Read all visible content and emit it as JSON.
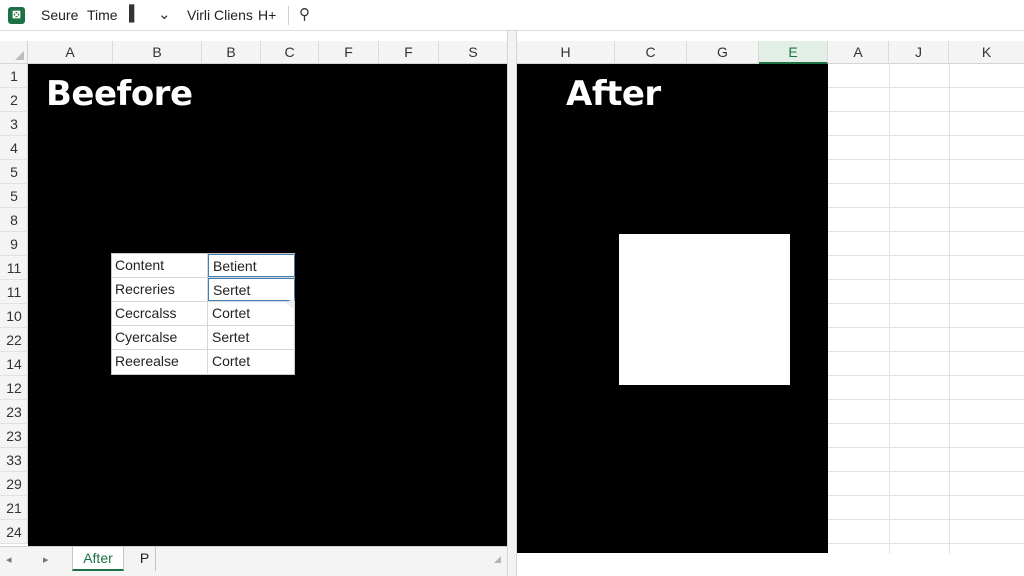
{
  "toolbar": {
    "app_icon": "spreadsheet-app-icon",
    "item1": "Seure",
    "item2": "Time",
    "item3": "Virli Cliens",
    "item4": "H+",
    "icons": [
      "bookmark-icon",
      "chevron-down-icon",
      "person-icon"
    ],
    "glyph_bookmark": "▌",
    "glyph_chevron": "⌄",
    "glyph_person": "⚲"
  },
  "left_pane": {
    "columns": [
      "A",
      "B",
      "B",
      "C",
      "F",
      "F",
      "S"
    ],
    "rows": [
      "1",
      "2",
      "3",
      "4",
      "5",
      "5",
      "8",
      "9",
      "11",
      "11",
      "10",
      "22",
      "14",
      "12",
      "23",
      "23",
      "33",
      "29",
      "21",
      "24"
    ],
    "title": "Beefore",
    "table": [
      [
        "Content",
        "Betient"
      ],
      [
        "Recreries",
        "Sertet"
      ],
      [
        "Cecrcalss",
        "Cortet"
      ],
      [
        "Cyercalse",
        "Sertet"
      ],
      [
        "Reerealse",
        "Cortet"
      ]
    ]
  },
  "right_pane": {
    "columns": [
      "H",
      "C",
      "G",
      "E",
      "A",
      "J",
      "K"
    ],
    "selected_column_index": 3,
    "title": "After"
  },
  "sheet_tabs": {
    "nav_left": "◂",
    "nav_right": "▸",
    "tabs": [
      "After",
      "P"
    ],
    "active_index": 0
  },
  "colors": {
    "accent": "#1e7145",
    "black_area": "#000000",
    "selection_border": "#3f7fb5"
  }
}
